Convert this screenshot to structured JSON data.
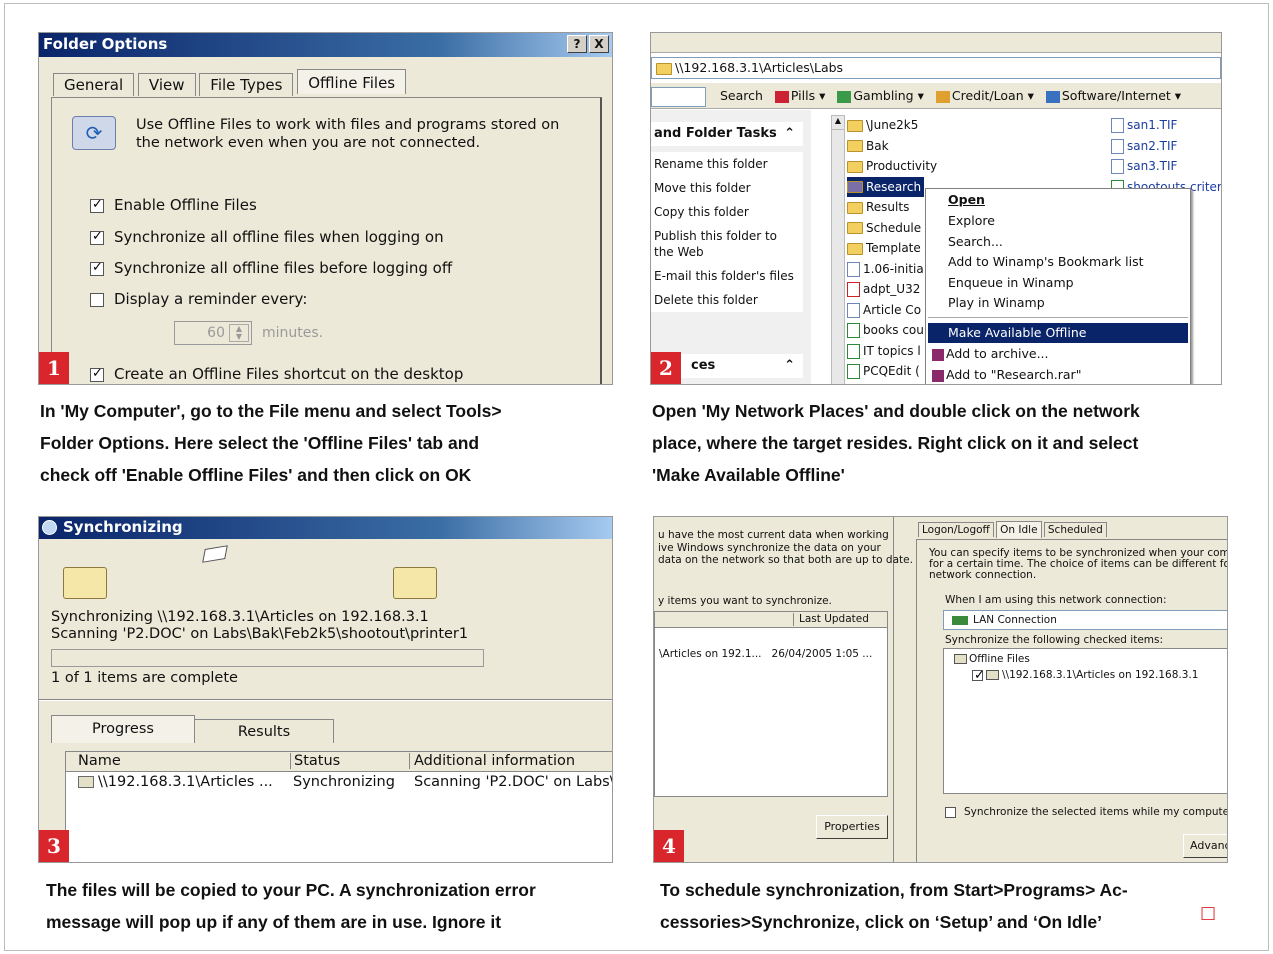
{
  "panel1": {
    "badge": "1",
    "title": "Folder Options",
    "help_btn": "?",
    "close_btn": "X",
    "tabs": [
      "General",
      "View",
      "File Types",
      "Offline Files"
    ],
    "description": "Use Offline Files to work with files and programs stored on the network even when you are not connected.",
    "options": [
      {
        "label": "Enable Offline Files",
        "checked": true
      },
      {
        "label": "Synchronize all offline files when logging on",
        "checked": true
      },
      {
        "label": "Synchronize all offline files before logging off",
        "checked": true
      },
      {
        "label": "Display a reminder every:",
        "checked": false
      }
    ],
    "reminder_value": "60",
    "reminder_unit": "minutes.",
    "shortcut_option": {
      "label": "Create an Offline Files shortcut on the desktop",
      "checked": true
    },
    "caption": [
      "In 'My Computer', go to the File menu and select Tools>",
      "Folder Options. Here select the 'Offline Files' tab and",
      "check off 'Enable Offline Files' and then click on OK"
    ]
  },
  "panel2": {
    "badge": "2",
    "address": "\\\\192.168.3.1\\Articles\\Labs",
    "search_label": "Search",
    "links": [
      "Pills",
      "Gambling",
      "Credit/Loan",
      "Software/Internet"
    ],
    "tasks_title": "and Folder Tasks",
    "tasks": [
      "Rename this folder",
      "Move this folder",
      "Copy this folder",
      "Publish this folder to the Web",
      "E-mail this folder's files",
      "Delete this folder"
    ],
    "places_title": "ces",
    "files_col1": [
      "\\June2k5",
      "Bak",
      "Productivity",
      "Research",
      "Results",
      "Schedule",
      "Template",
      "1.06-initia",
      "adpt_U32",
      "Article Co",
      "books cou",
      "IT topics l",
      "PCQEdit ("
    ],
    "files_col2": [
      "san1.TIF",
      "san2.TIF",
      "san3.TIF",
      "shootouts criteri"
    ],
    "context_menu": [
      "Open",
      "Explore",
      "Search...",
      "Add to Winamp's Bookmark list",
      "Enqueue in Winamp",
      "Play in Winamp",
      "Make Available Offline",
      "Add to archive...",
      "Add to \"Research.rar\""
    ],
    "caption": [
      "Open 'My Network Places' and double click on the network",
      "place, where the target resides. Right click on it  and select",
      "'Make Available Offline'"
    ]
  },
  "panel3": {
    "badge": "3",
    "title": "Synchronizing",
    "status_line1": "Synchronizing \\\\192.168.3.1\\Articles on 192.168.3.1",
    "status_line2": "Scanning 'P2.DOC' on Labs\\Bak\\Feb2k5\\shootout\\printer1",
    "progress_text": "1 of 1 items are complete",
    "tabs": [
      "Progress",
      "Results"
    ],
    "columns": [
      "Name",
      "Status",
      "Additional information"
    ],
    "row": [
      "\\\\192.168.3.1\\Articles ...",
      "Synchronizing",
      "Scanning 'P2.DOC' on Labs\\"
    ],
    "caption": [
      "The files will be copied to your PC. A synchronization error",
      "message will pop up if any of them are in use. Ignore it"
    ]
  },
  "panel4": {
    "badge": "4",
    "left_text": [
      "u have the most current data when working",
      "ive Windows synchronize the data on your",
      "data on the network so that both are up to date."
    ],
    "left_prompt": "y items you want to synchronize.",
    "left_col": "Last Updated",
    "left_row": "\\Articles on 192.1...   26/04/2005 1:05 ...",
    "properties_btn": "Properties",
    "tabs": [
      "Logon/Logoff",
      "On Idle",
      "Scheduled"
    ],
    "desc": [
      "You can specify items to be synchronized when your computer i",
      "for a certain time. The choice of items can be different for each",
      "network connection."
    ],
    "conn_label": "When I am using this network connection:",
    "conn_value": "LAN Connection",
    "items_label": "Synchronize the following checked items:",
    "tree_root": "Offline Files",
    "tree_item": "\\\\192.168.3.1\\Articles on 192.168.3.1",
    "idle_option": "Synchronize the selected items while my computer is idle.",
    "advanced_btn": "Advanc",
    "caption": [
      "To schedule synchronization, from Start>Programs> Ac-",
      "cessories>Synchronize, click on ‘Setup’ and ‘On Idle’"
    ],
    "end_mark": "□"
  }
}
